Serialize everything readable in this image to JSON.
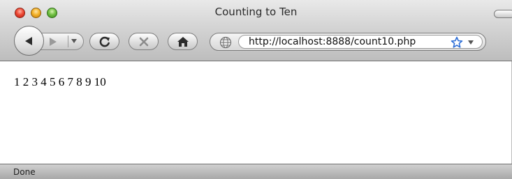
{
  "window": {
    "title": "Counting to Ten"
  },
  "toolbar": {
    "back_icon": "back-arrow-icon",
    "forward_icon": "forward-arrow-icon",
    "reload_icon": "reload-icon",
    "stop_icon": "stop-icon",
    "home_icon": "home-icon",
    "bookmark_icon": "star-icon"
  },
  "address_bar": {
    "url": "http://localhost:8888/count10.php"
  },
  "page": {
    "body_text": "1 2 3 4 5 6 7 8 9 10"
  },
  "status_bar": {
    "text": "Done"
  },
  "colors": {
    "close": "#ee4a36",
    "minimize": "#f4b32b",
    "zoom": "#72c043",
    "star": "#2f6fd6"
  }
}
